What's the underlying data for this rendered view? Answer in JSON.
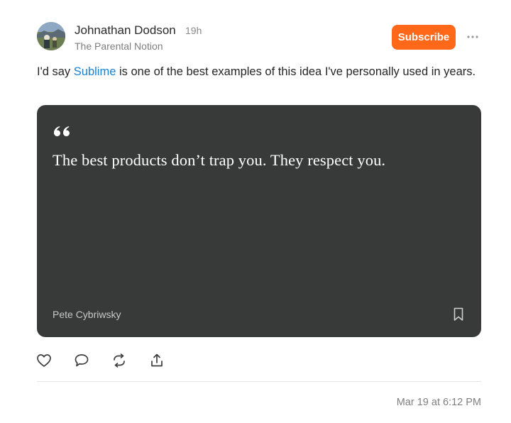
{
  "post": {
    "author": "Johnathan Dodson",
    "time_ago": "19h",
    "publication": "The Parental Notion",
    "subscribe_label": "Subscribe",
    "text_before_link": "I'd say ",
    "link_text": "Sublime",
    "text_after_link": " is one of the best examples of this idea I've personally used in years.",
    "date": "Mar 19 at 6:12 PM"
  },
  "quote": {
    "text": "The best products don’t trap you. They respect you.",
    "author": "Pete Cybriwsky"
  },
  "colors": {
    "accent": "#ff6719",
    "link": "#1a82d6",
    "card_bg": "#383939"
  },
  "icons": {
    "more": "more-horizontal-icon",
    "quote": "quote-icon",
    "bookmark": "bookmark-icon",
    "like": "heart-icon",
    "comment": "comment-icon",
    "restack": "restack-icon",
    "share": "share-icon"
  }
}
